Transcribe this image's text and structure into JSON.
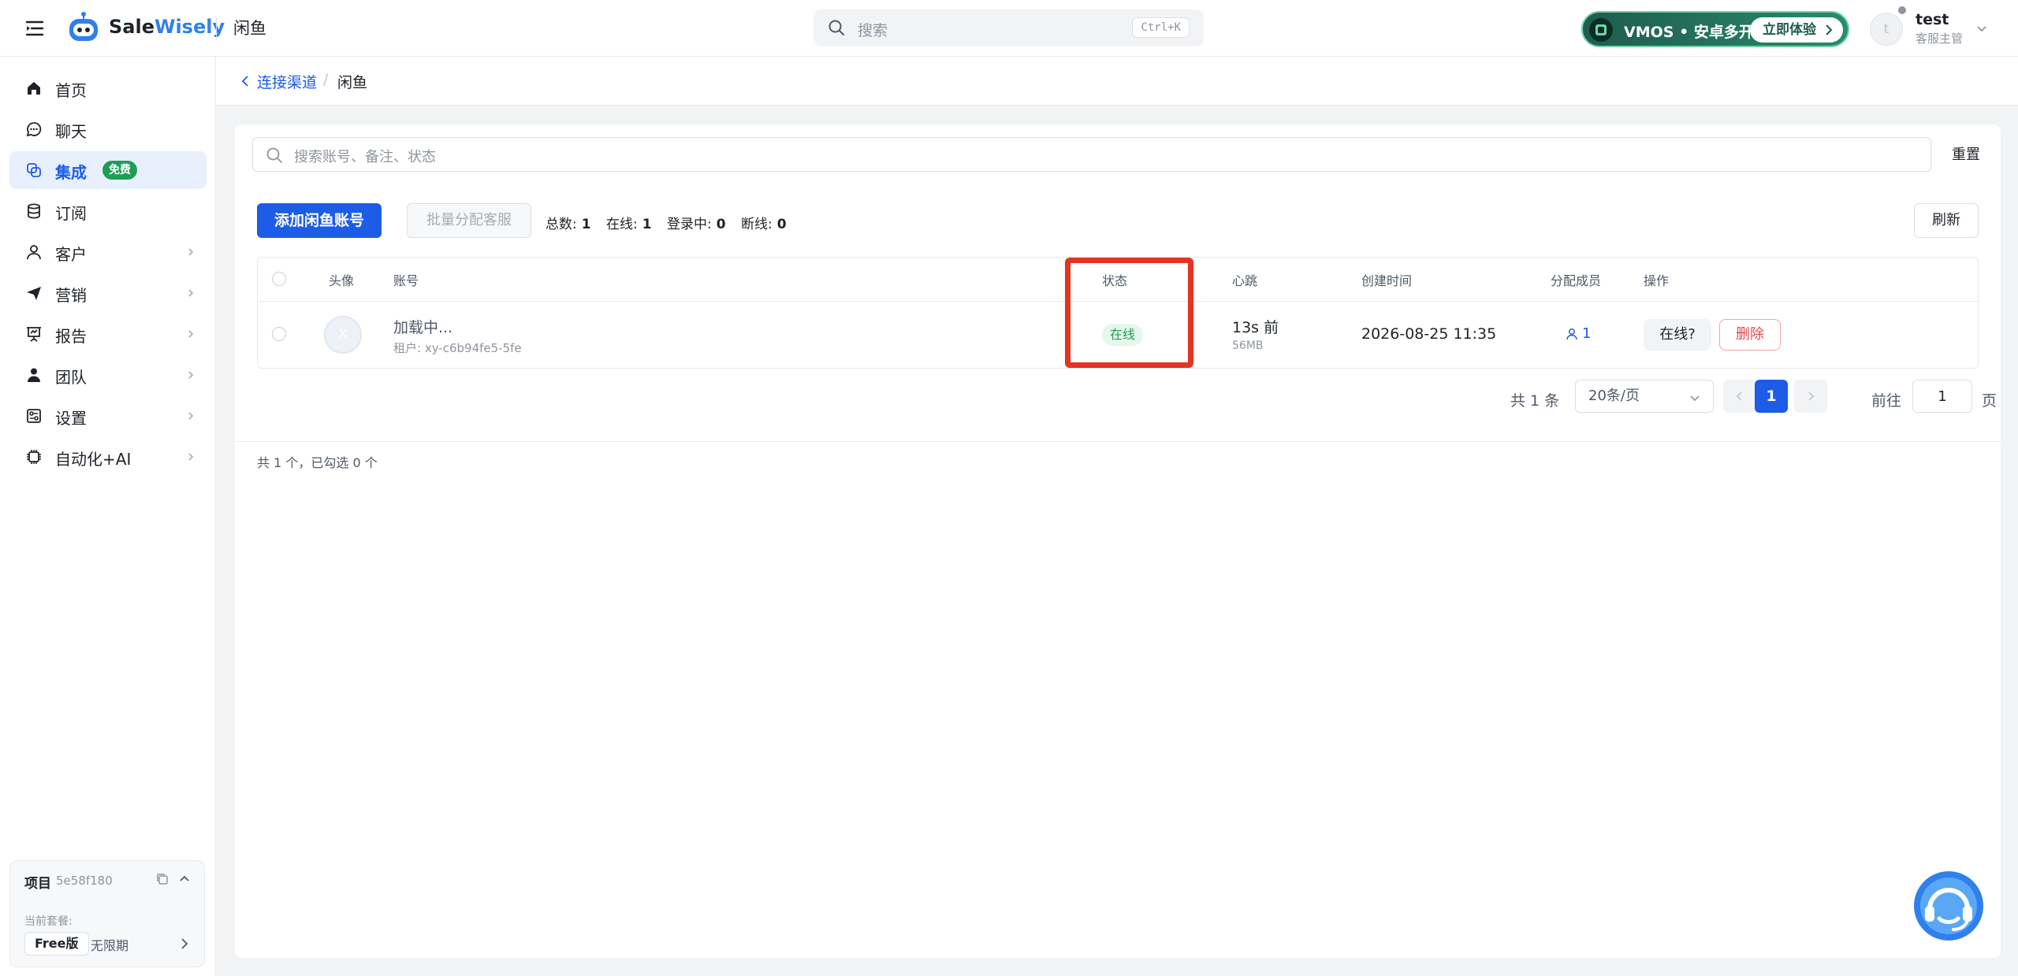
{
  "app": {
    "brand_part1": "Sale",
    "brand_part2": "Wisely",
    "current_page": "闲鱼"
  },
  "search": {
    "placeholder": "搜索",
    "shortcut": "Ctrl+K"
  },
  "promo": {
    "text": "VMOS • 安卓多开",
    "cta": "立即体验"
  },
  "user": {
    "avatar_initial": "t",
    "name": "test",
    "role": "客服主管"
  },
  "sidebar": {
    "items": [
      {
        "label": "首页",
        "icon": "home-icon"
      },
      {
        "label": "聊天",
        "icon": "chat-icon"
      },
      {
        "label": "集成",
        "icon": "integration-icon",
        "badge": "免费",
        "active": true
      },
      {
        "label": "订阅",
        "icon": "database-icon"
      },
      {
        "label": "客户",
        "icon": "user-icon",
        "has_children": true
      },
      {
        "label": "营销",
        "icon": "send-icon",
        "has_children": true
      },
      {
        "label": "报告",
        "icon": "presentation-icon",
        "has_children": true
      },
      {
        "label": "团队",
        "icon": "team-icon",
        "has_children": true
      },
      {
        "label": "设置",
        "icon": "settings-icon",
        "has_children": true
      },
      {
        "label": "自动化+AI",
        "icon": "chip-icon",
        "has_children": true
      }
    ],
    "project": {
      "title": "项目",
      "id": "5e58f180",
      "plan_label": "当前套餐:",
      "plan": "Free版",
      "term": "无限期"
    }
  },
  "breadcrumb": {
    "parent": "连接渠道",
    "separator": "/",
    "current": "闲鱼"
  },
  "filter": {
    "placeholder": "搜索账号、备注、状态",
    "reset_label": "重置"
  },
  "toolbar": {
    "add_label": "添加闲鱼账号",
    "batch_label": "批量分配客服",
    "refresh_label": "刷新",
    "stats": {
      "total_label": "总数:",
      "total": "1",
      "online_label": "在线:",
      "online": "1",
      "logging_label": "登录中:",
      "logging": "0",
      "offline_label": "断线:",
      "offline": "0"
    }
  },
  "table": {
    "columns": [
      "头像",
      "账号",
      "状态",
      "心跳",
      "创建时间",
      "分配成员",
      "操作"
    ],
    "rows": [
      {
        "avatar_initial": "X",
        "account": "加载中...",
        "tenant": "租户: xy-c6b94fe5-5fe",
        "status": "在线",
        "heartbeat": "13s 前",
        "memory": "56MB",
        "created": "2026-08-25 11:35",
        "members": "1",
        "action_status": "在线?",
        "action_delete": "删除"
      }
    ]
  },
  "pagination": {
    "total_text": "共 1 条",
    "page_size": "20条/页",
    "current_page": "1",
    "goto_label": "前往",
    "goto_value": "1",
    "goto_unit": "页"
  },
  "selection_summary": "共 1 个，已勾选 0 个",
  "colors": {
    "primary": "#1d5ce6",
    "success": "#1f9d55",
    "danger": "#e5484d",
    "highlight": "#e53422"
  }
}
